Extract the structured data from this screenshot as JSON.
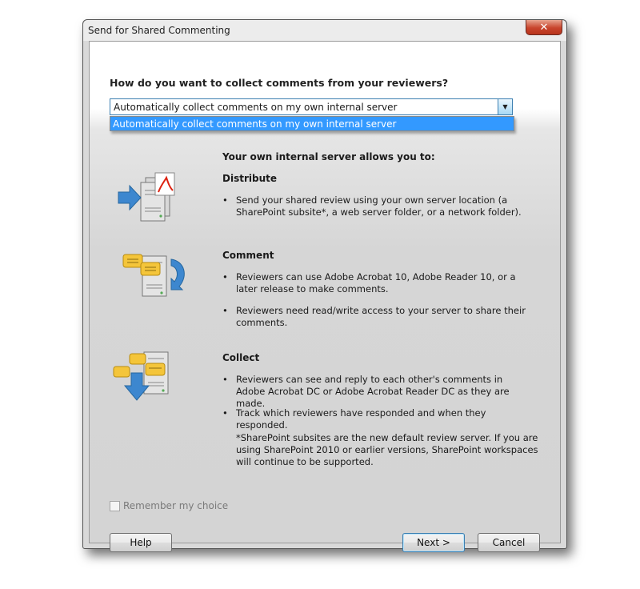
{
  "window": {
    "title": "Send for Shared Commenting",
    "close_glyph": "✕"
  },
  "question": "How do you want to collect comments from your reviewers?",
  "collect_method": {
    "selected": "Automatically collect comments on my own internal server",
    "options": [
      "Automatically collect comments on my own internal server"
    ]
  },
  "info": {
    "heading": "Your own internal server allows you to:",
    "sections": [
      {
        "title": "Distribute",
        "icon": "server-distribute-icon",
        "bullets": [
          "Send your shared review using your own server location (a SharePoint subsite*, a web server folder, or a network folder)."
        ]
      },
      {
        "title": "Comment",
        "icon": "server-comment-icon",
        "bullets": [
          "Reviewers can use Adobe Acrobat 10, Adobe Reader 10, or a later release to make comments.",
          "Reviewers need read/write access to your server to share their comments."
        ]
      },
      {
        "title": "Collect",
        "icon": "server-collect-icon",
        "bullets": [
          "Reviewers can see and reply to each other's comments in Adobe Acrobat DC or Adobe Acrobat Reader DC as they are made.",
          "Track which reviewers have responded and when they responded."
        ]
      }
    ],
    "note": "*SharePoint subsites are the new default review server. If you are using SharePoint 2010 or earlier versions, SharePoint workspaces will continue to be supported."
  },
  "remember_choice": {
    "label": "Remember my choice",
    "checked": false,
    "enabled": false
  },
  "buttons": {
    "help": "Help",
    "next": "Next >",
    "cancel": "Cancel"
  },
  "colors": {
    "accent": "#3399ff",
    "close_button": "#c8442c",
    "focus_border": "#3c7fb1"
  },
  "bullet_glyph": "•"
}
